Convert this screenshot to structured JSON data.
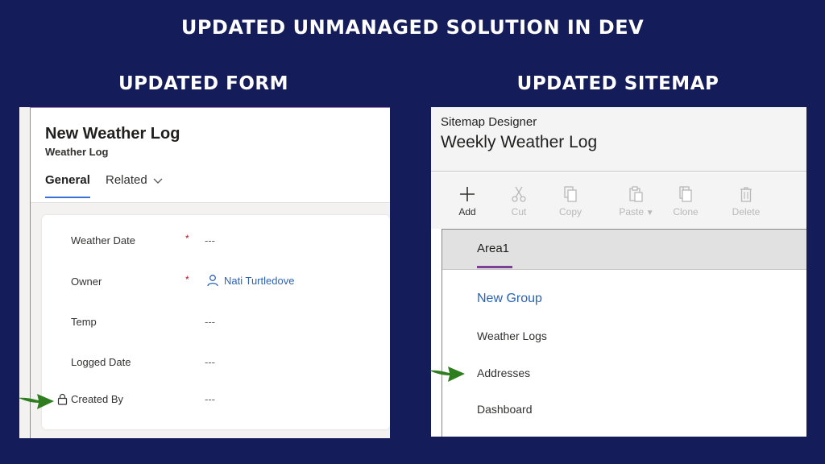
{
  "banner": {
    "title": "UPDATED UNMANAGED SOLUTION IN DEV"
  },
  "form_section": {
    "heading": "UPDATED FORM",
    "title": "New Weather Log",
    "subtitle": "Weather Log",
    "tabs": [
      {
        "label": "General",
        "selected": true
      },
      {
        "label": "Related",
        "selected": false
      }
    ],
    "fields": [
      {
        "label": "Weather Date",
        "required": true,
        "value": "---"
      },
      {
        "label": "Owner",
        "required": true,
        "value": "Nati Turtledove"
      },
      {
        "label": "Temp",
        "required": false,
        "value": "---"
      },
      {
        "label": "Logged Date",
        "required": false,
        "value": "---"
      },
      {
        "label": "Created By",
        "required": false,
        "value": "---",
        "locked": true
      }
    ],
    "required_marker": "*"
  },
  "sitemap_section": {
    "heading": "UPDATED SITEMAP",
    "designer_label": "Sitemap Designer",
    "sitemap_name": "Weekly Weather Log",
    "toolbar": [
      {
        "label": "Add",
        "enabled": true,
        "icon": "plus-icon"
      },
      {
        "label": "Cut",
        "enabled": false,
        "icon": "scissors-icon"
      },
      {
        "label": "Copy",
        "enabled": false,
        "icon": "copy-icon"
      },
      {
        "label": "Paste",
        "enabled": false,
        "icon": "paste-icon"
      },
      {
        "label": "Clone",
        "enabled": false,
        "icon": "clone-icon"
      },
      {
        "label": "Delete",
        "enabled": false,
        "icon": "trash-icon"
      }
    ],
    "area": "Area1",
    "group": "New Group",
    "subareas": [
      "Weather Logs",
      "Addresses",
      "Dashboard"
    ]
  },
  "colors": {
    "background": "#141c5a",
    "accent_blue": "#2b63b5",
    "tab_underline": "#3b6fd1",
    "area_underline": "#7b3f95",
    "required": "#c50f1f",
    "arrow_green": "#2e7d1f"
  }
}
